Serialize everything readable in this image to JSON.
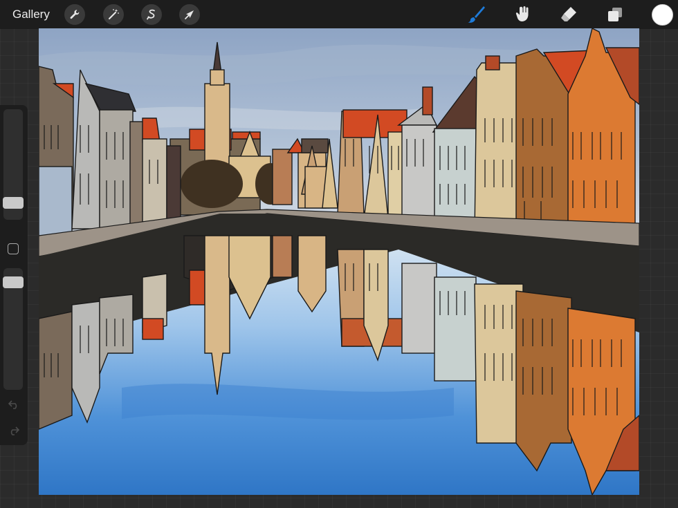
{
  "app": {
    "gallery_label": "Gallery"
  },
  "toolbar": {
    "left_tools": [
      "wrench-icon",
      "magic-wand-icon",
      "selection-icon",
      "transform-arrow-icon"
    ],
    "right_tools": [
      "brush-icon",
      "smudge-icon",
      "eraser-icon",
      "layers-icon"
    ],
    "active_tool": "brush",
    "active_color": "#1e7bd9",
    "current_color": "#ffffff"
  },
  "sidebar": {
    "brush_size_level": 0.2,
    "opacity_level": 0.92,
    "undo_icon": "undo-icon",
    "redo_icon": "redo-icon"
  },
  "artwork": {
    "subject": "canal-with-gabled-houses-and-reflection",
    "colors": {
      "sky": "#9db4cf",
      "water": "#4a8fd6",
      "quay": "#2b2a27",
      "roof": "#d24a23",
      "orange_house": "#dc7a32",
      "brown_house": "#a86934",
      "cream_house": "#dcc79b",
      "tan_house": "#c9a074",
      "grey_house": "#a8a8a6"
    }
  }
}
